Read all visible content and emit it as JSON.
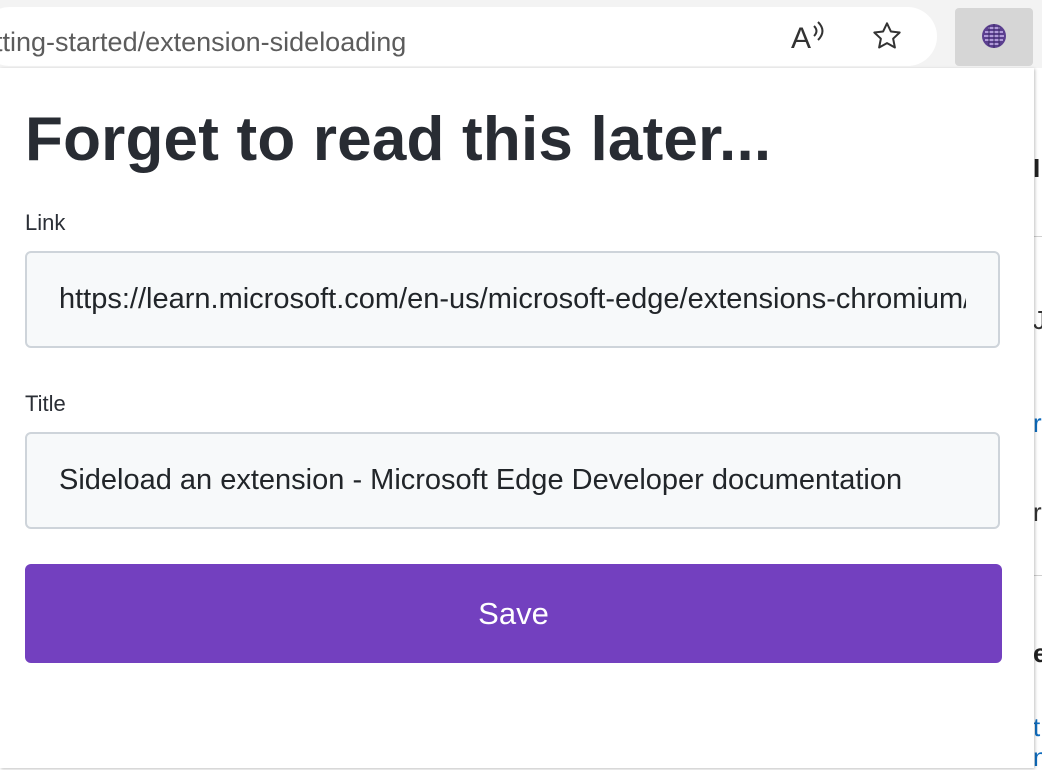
{
  "browser": {
    "address_text": "etting-started/extension-sideloading",
    "read_aloud_icon": "read-aloud-icon",
    "favorite_icon": "star-icon",
    "extension_icon": "extension-icon"
  },
  "popup": {
    "title": "Forget to read this later...",
    "link_label": "Link",
    "link_value": "https://learn.microsoft.com/en-us/microsoft-edge/extensions-chromium/getting-started/extension-sideloading",
    "title_label": "Title",
    "title_value": "Sideload an extension - Microsoft Edge Developer documentation",
    "save_label": "Save"
  },
  "background_page": {
    "fragments": [
      "I",
      "J",
      "r",
      "r",
      "e",
      "t",
      "n"
    ]
  },
  "colors": {
    "accent": "#7340bf",
    "heading": "#282c33",
    "input_border": "#ced4da",
    "input_bg": "#f7f9fa",
    "link_blue": "#0f6cbd"
  }
}
